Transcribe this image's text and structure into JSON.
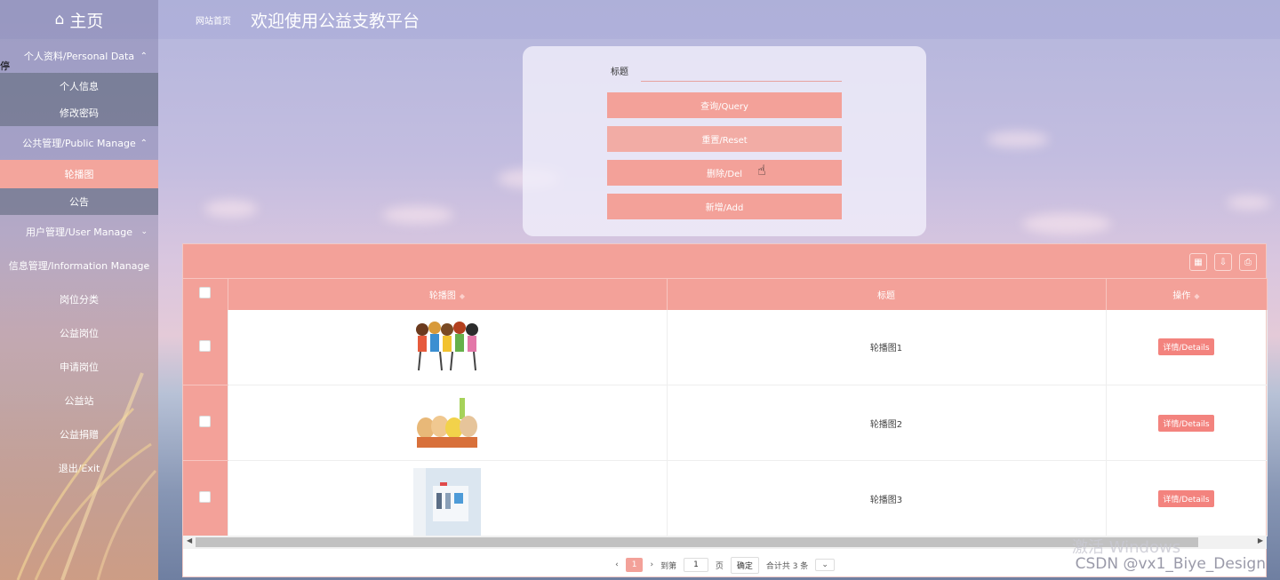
{
  "brand": {
    "icon": "home-icon",
    "label": "主页"
  },
  "sidebar": {
    "items": [
      {
        "type": "group",
        "label": "个人资料/Personal Data",
        "chev": "^"
      },
      {
        "type": "item",
        "label": "个人信息"
      },
      {
        "type": "item",
        "label": "修改密码"
      },
      {
        "type": "group",
        "label": "公共管理/Public Manage",
        "chev": "^"
      },
      {
        "type": "item",
        "label": "轮播图",
        "active": true
      },
      {
        "type": "item",
        "label": "公告"
      },
      {
        "type": "plain",
        "label": "用户管理/User Manage"
      },
      {
        "type": "plain",
        "label": "信息管理/Information Manage"
      },
      {
        "type": "plain",
        "label": "岗位分类"
      },
      {
        "type": "plain",
        "label": "公益岗位"
      },
      {
        "type": "plain",
        "label": "申请岗位"
      },
      {
        "type": "plain",
        "label": "公益站"
      },
      {
        "type": "plain",
        "label": "公益捐赠"
      },
      {
        "type": "plain",
        "label": "退出/Exit"
      }
    ],
    "stray_glyph": "停"
  },
  "topbar": {
    "breadcrumb": "网站首页",
    "title": "欢迎使用公益支教平台"
  },
  "search": {
    "field_label": "标题",
    "field_value": "",
    "query_label": "查询/Query",
    "reset_label": "重置/Reset",
    "delete_label": "删除/Del",
    "add_label": "新增/Add"
  },
  "table": {
    "toolbar_icons": [
      "columns-icon",
      "export-icon",
      "print-icon"
    ],
    "columns": [
      "轮播图",
      "标题",
      "操作"
    ],
    "rows": [
      {
        "image": "kids-running-cartoon",
        "title": "轮播图1",
        "action": "详情/Details"
      },
      {
        "image": "kids-group-cartoon",
        "title": "轮播图2",
        "action": "详情/Details"
      },
      {
        "image": "classroom-photo",
        "title": "轮播图3",
        "action": "详情/Details"
      }
    ]
  },
  "pager": {
    "current_page": "1",
    "goto_label": "到第",
    "goto_value": "1",
    "page_unit": "页",
    "confirm_label": "确定",
    "total_label": "合计共 3 条"
  },
  "overlay": {
    "watermark": "CSDN @vx1_Biye_Design",
    "windows_text": "激活 Windows"
  },
  "colors": {
    "accent": "#f3a199",
    "detail": "#f3837e"
  }
}
